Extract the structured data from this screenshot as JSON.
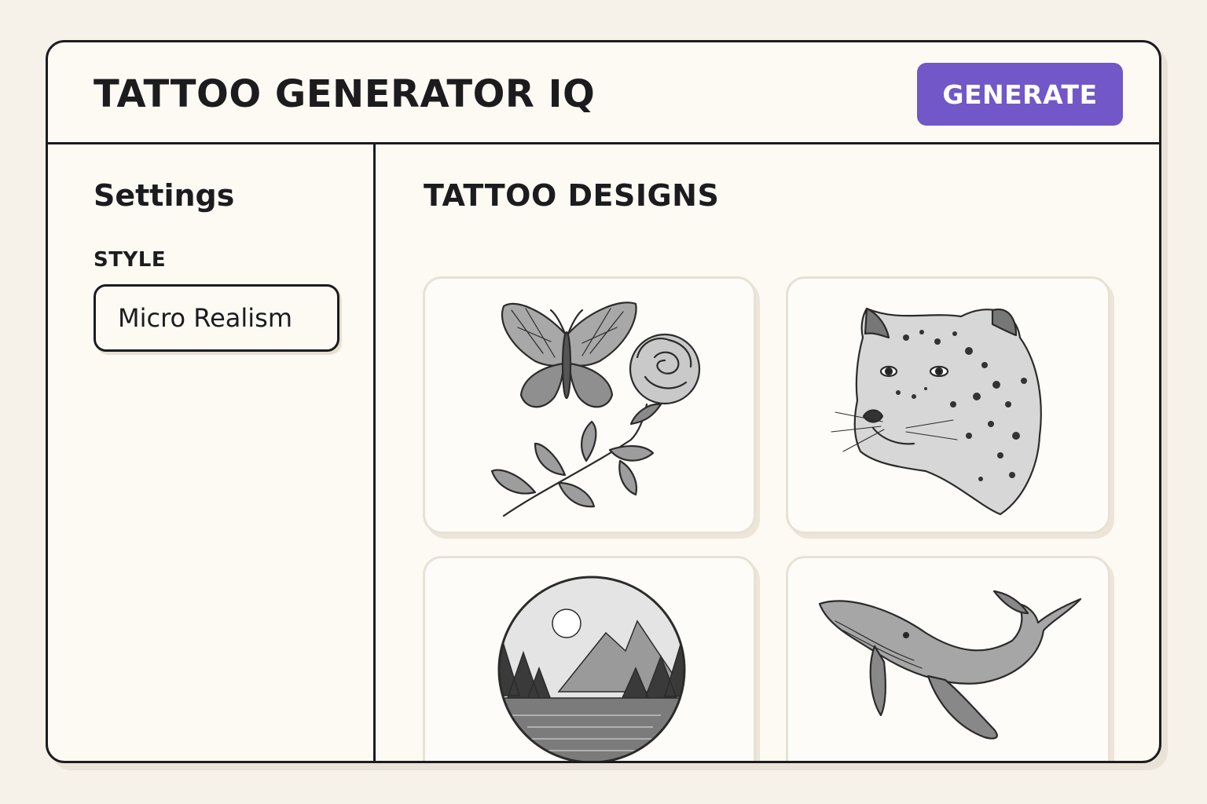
{
  "header": {
    "title": "TATTOO GENERATOR IQ",
    "generate_label": "GENERATE"
  },
  "sidebar": {
    "title": "Settings",
    "style_label": "STYLE",
    "style_value": "Micro Realism"
  },
  "main": {
    "title": "TATTOO DESIGNS",
    "designs": [
      {
        "icon": "butterfly-rose-icon"
      },
      {
        "icon": "leopard-head-icon"
      },
      {
        "icon": "mountain-lake-circle-icon"
      },
      {
        "icon": "whale-icon"
      }
    ]
  },
  "colors": {
    "accent": "#7157c7",
    "background": "#f6f1e9",
    "panel": "#fdfaf4",
    "ink": "#1c1c1f"
  }
}
